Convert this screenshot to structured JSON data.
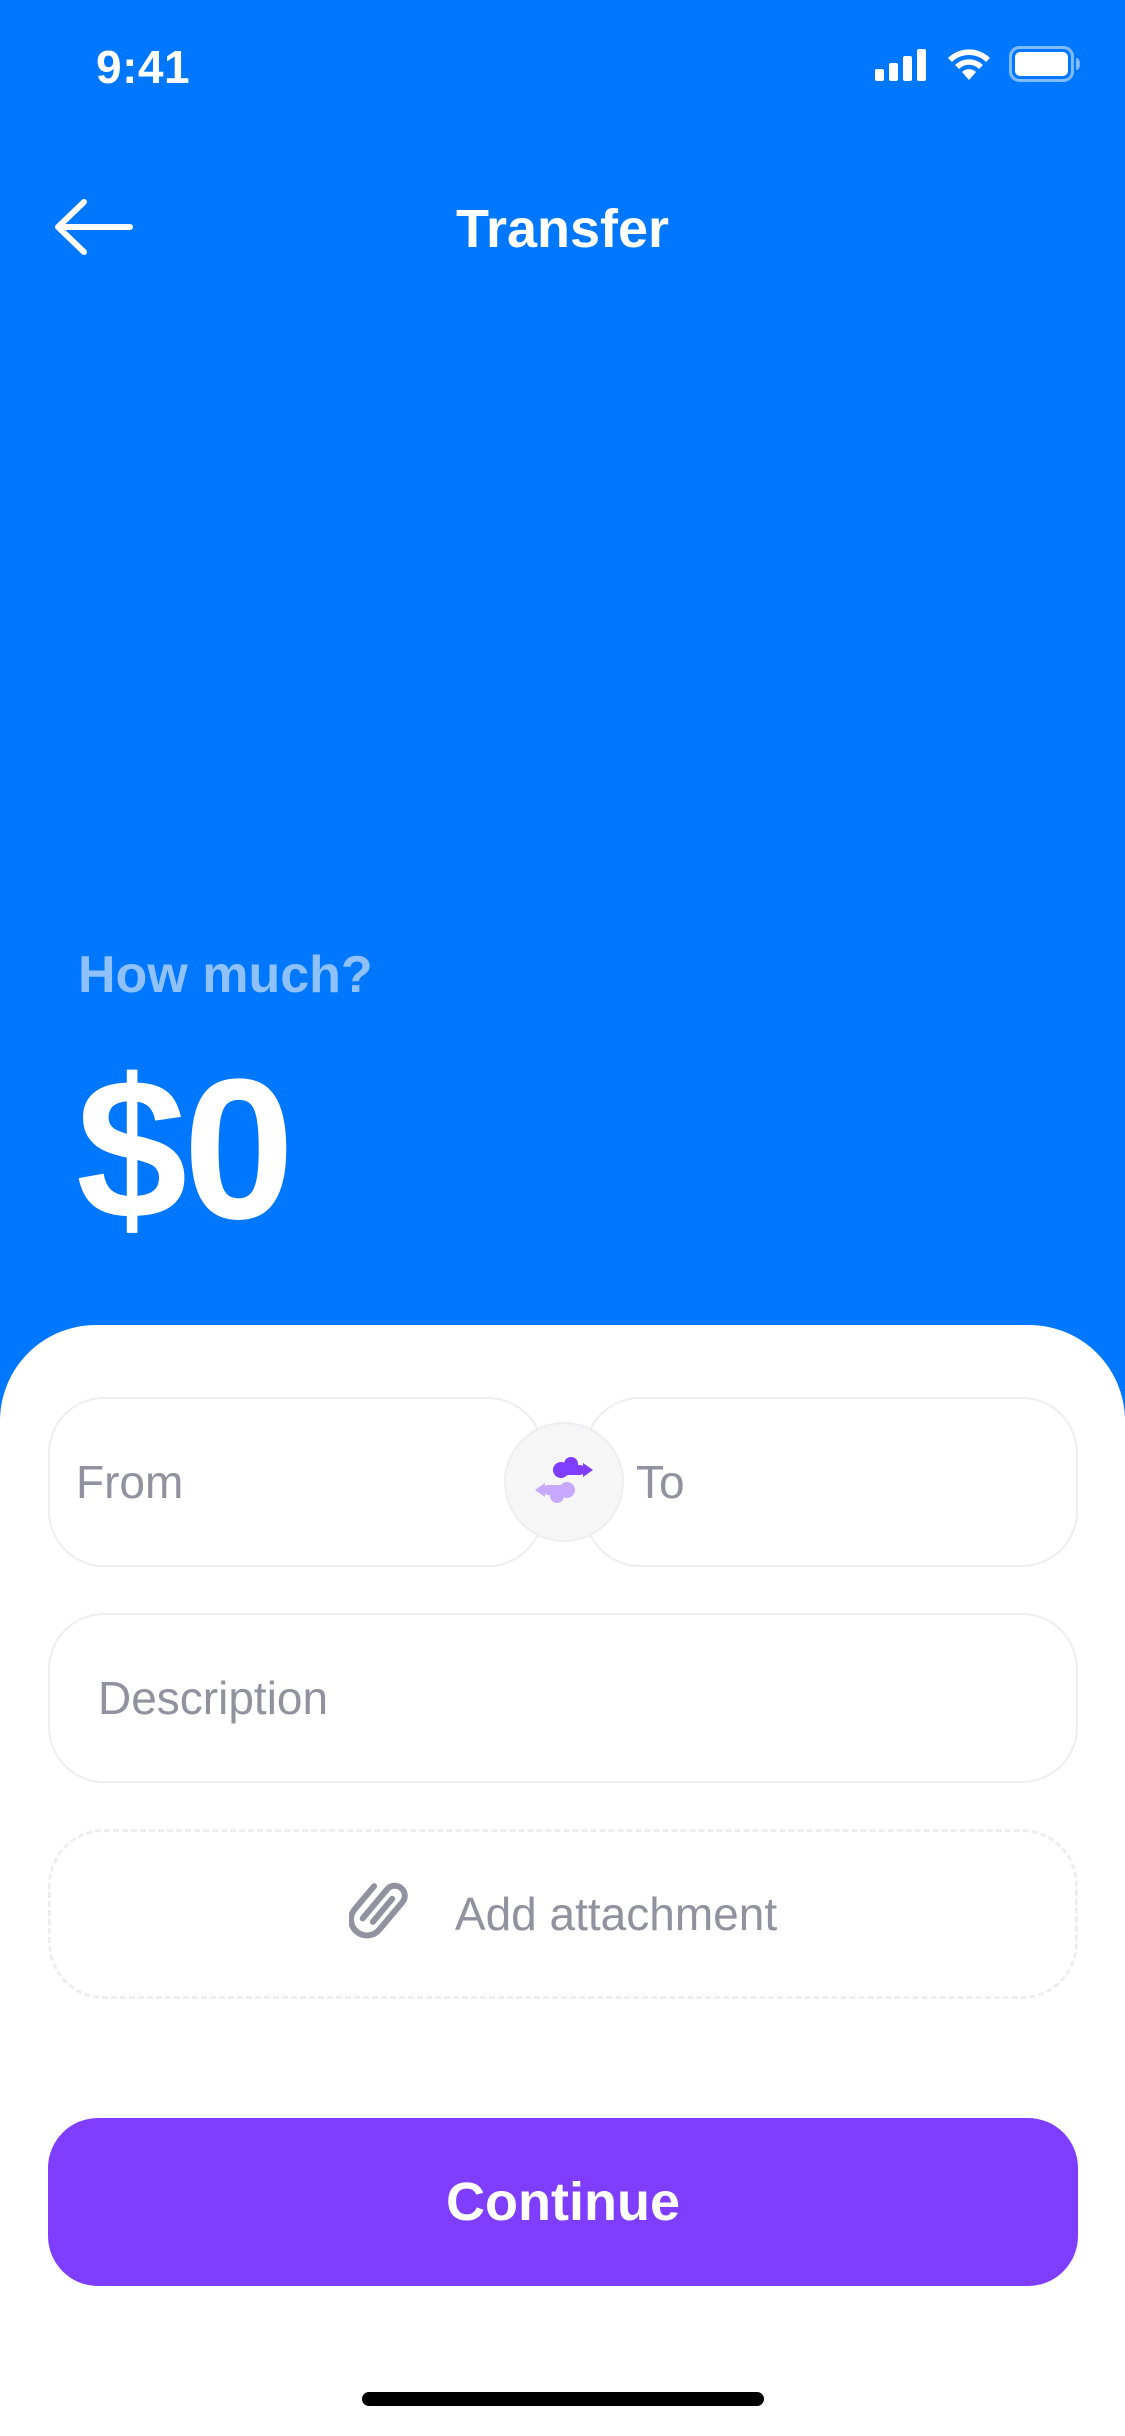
{
  "status_bar": {
    "time": "9:41"
  },
  "nav": {
    "title": "Transfer"
  },
  "amount_section": {
    "prompt": "How much?",
    "amount": "$0"
  },
  "form": {
    "from_placeholder": "From",
    "to_placeholder": "To",
    "description_placeholder": "Description",
    "attachment_label": "Add attachment",
    "continue_label": "Continue"
  },
  "icons": {
    "back": "arrow-left-icon",
    "swap": "swap-icon",
    "attachment": "paperclip-icon",
    "signal": "cellular-signal-icon",
    "wifi": "wifi-icon",
    "battery": "battery-icon"
  },
  "colors": {
    "header_background": "#0077FF",
    "prompt_text": "#8FC1FF",
    "button_primary": "#7F3DFF",
    "placeholder_text": "#91919F",
    "field_border": "#EEEEF1"
  }
}
